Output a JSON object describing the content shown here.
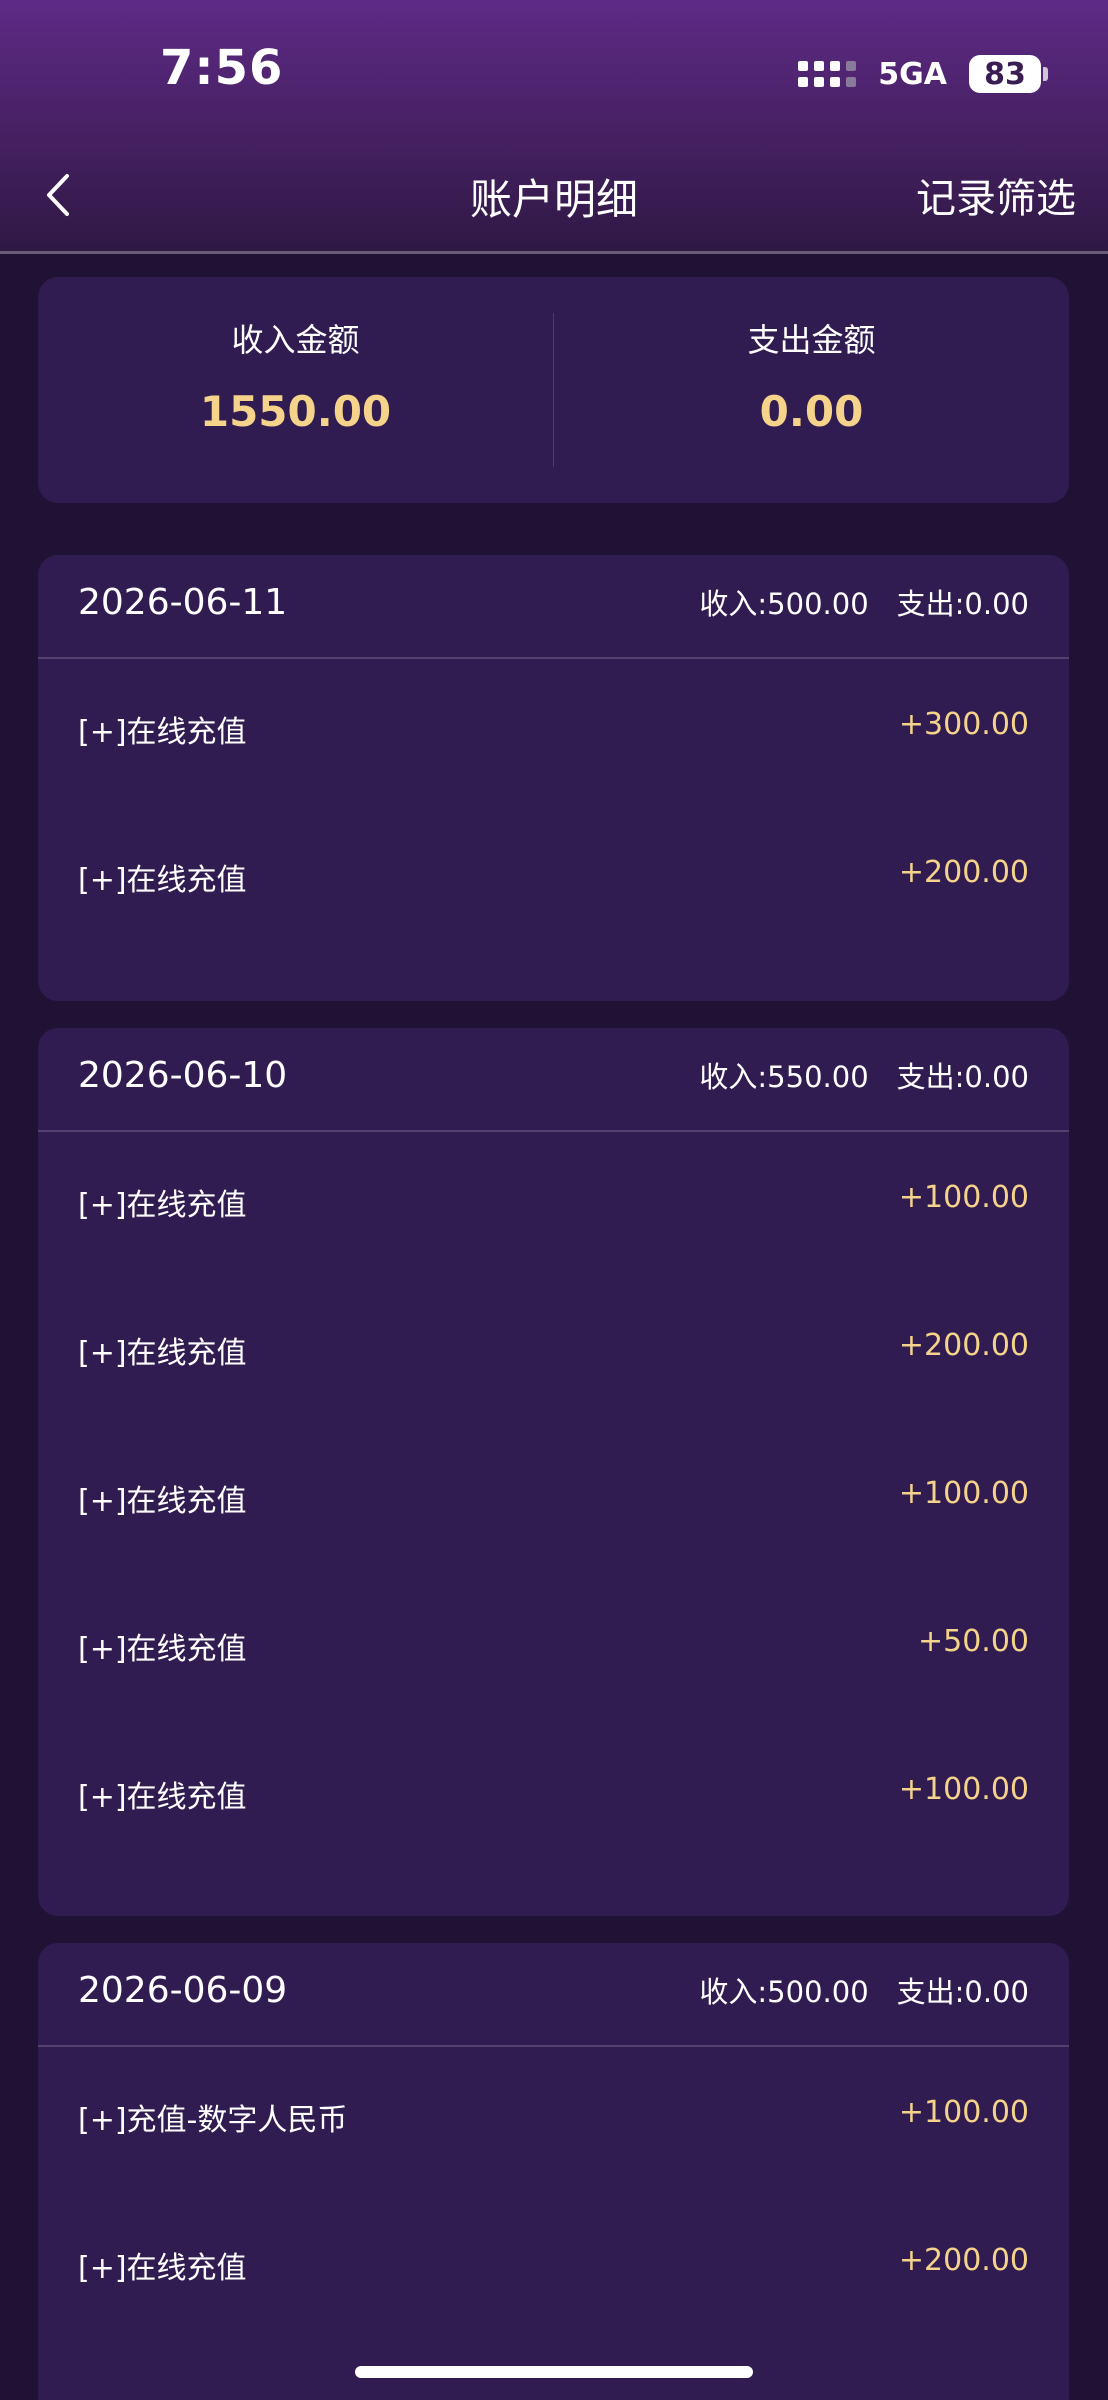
{
  "status_bar": {
    "time": "7:56",
    "network": "5GA",
    "battery": "83"
  },
  "nav": {
    "title": "账户明细",
    "filter_label": "记录筛选",
    "back_icon": "chevron-left-icon"
  },
  "summary": {
    "income_label": "收入金额",
    "income_value": "1550.00",
    "expense_label": "支出金额",
    "expense_value": "0.00"
  },
  "groups": [
    {
      "date": "2026-06-11",
      "income": "收入:500.00",
      "expense": "支出:0.00",
      "rows": [
        {
          "title": "[+]在线充值",
          "amount": "+300.00"
        },
        {
          "title": "[+]在线充值",
          "amount": "+200.00"
        }
      ]
    },
    {
      "date": "2026-06-10",
      "income": "收入:550.00",
      "expense": "支出:0.00",
      "rows": [
        {
          "title": "[+]在线充值",
          "amount": "+100.00"
        },
        {
          "title": "[+]在线充值",
          "amount": "+200.00"
        },
        {
          "title": "[+]在线充值",
          "amount": "+100.00"
        },
        {
          "title": "[+]在线充值",
          "amount": "+50.00"
        },
        {
          "title": "[+]在线充值",
          "amount": "+100.00"
        }
      ]
    },
    {
      "date": "2026-06-09",
      "income": "收入:500.00",
      "expense": "支出:0.00",
      "rows": [
        {
          "title": "[+]充值-数字人民币",
          "amount": "+100.00"
        },
        {
          "title": "[+]在线充值",
          "amount": "+200.00"
        }
      ]
    }
  ],
  "colors": {
    "accent_amount": "#f5d38a",
    "card_bg": "#311c52",
    "page_bg": "#1f1235"
  }
}
